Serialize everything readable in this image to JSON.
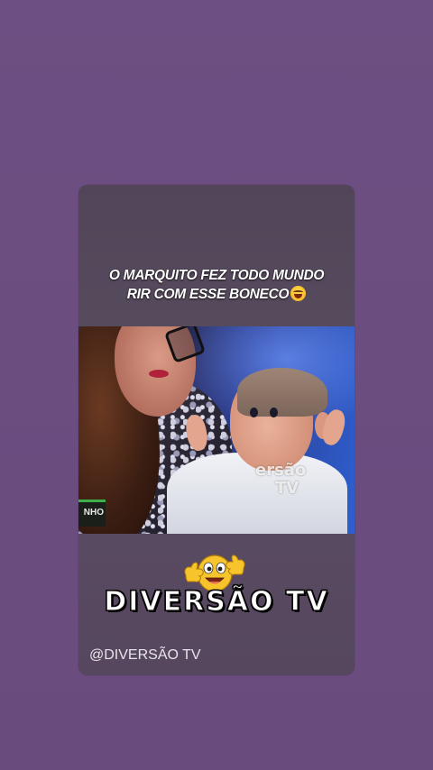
{
  "story": {
    "caption_line1": "O MARQUITO FEZ TODO MUNDO",
    "caption_line2": "RIR COM ESSE BONECO",
    "caption_emoji": "laughing-face-icon",
    "video": {
      "watermark_line1": "ersão",
      "watermark_line2": "TV",
      "tv_logo_text": "NHO"
    },
    "brand_title": "DIVERSÃO TV",
    "brand_emoji": "thumbs-up-face-icon",
    "handle": "@DIVERSÃO TV"
  },
  "colors": {
    "background": "#6b4d80",
    "card": "#56475e",
    "text": "#ffffff"
  }
}
